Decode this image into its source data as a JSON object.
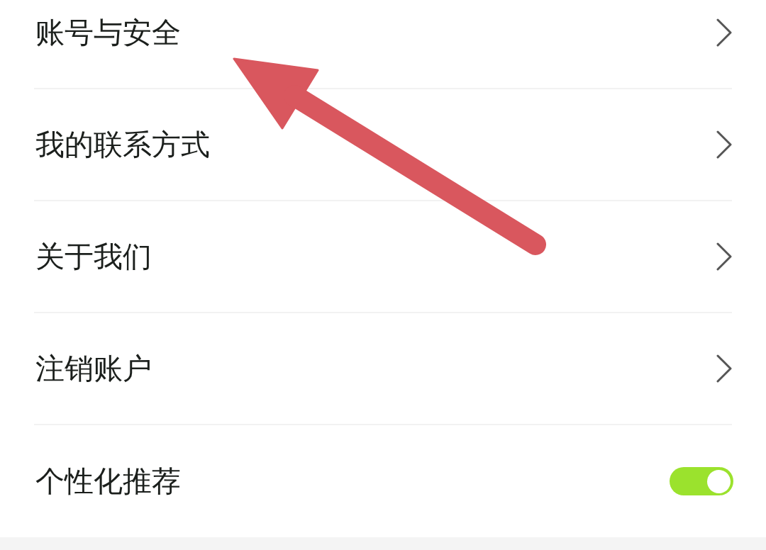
{
  "settings": {
    "items": [
      {
        "kind": "link",
        "label": "账号与安全"
      },
      {
        "kind": "link",
        "label": "我的联系方式"
      },
      {
        "kind": "link",
        "label": "关于我们"
      },
      {
        "kind": "link",
        "label": "注销账户"
      },
      {
        "kind": "toggle",
        "label": "个性化推荐",
        "on": true
      }
    ]
  },
  "annotation": {
    "kind": "arrow"
  }
}
